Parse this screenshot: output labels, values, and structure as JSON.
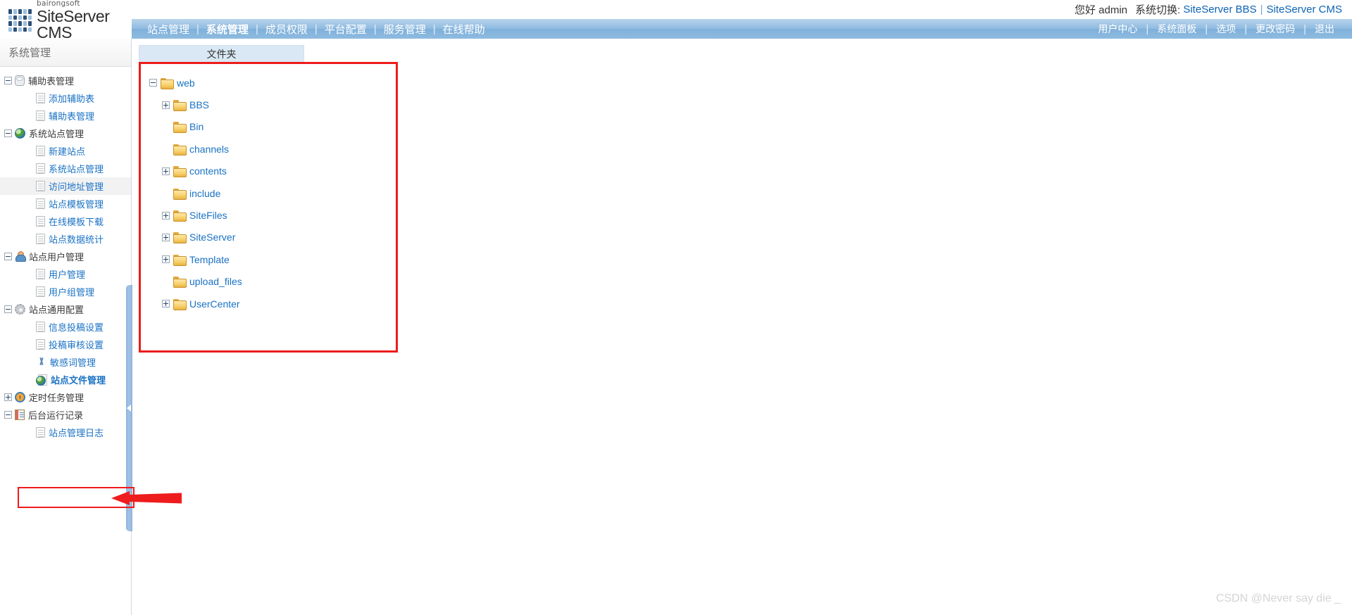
{
  "brand": {
    "sub": "bairongsoft",
    "name": "SiteServer CMS",
    "logo_icon": "grid-logo-icon"
  },
  "topbar": {
    "greeting": "您好 admin",
    "switch_label": "系统切换:",
    "switch_links": [
      "SiteServer BBS",
      "SiteServer CMS"
    ],
    "separator": "|"
  },
  "nav": {
    "primary": [
      {
        "label": "站点管理",
        "active": false
      },
      {
        "label": "系统管理",
        "active": true
      },
      {
        "label": "成员权限",
        "active": false
      },
      {
        "label": "平台配置",
        "active": false
      },
      {
        "label": "服务管理",
        "active": false
      },
      {
        "label": "在线帮助",
        "active": false
      }
    ],
    "secondary": [
      {
        "label": "用户中心"
      },
      {
        "label": "系统面板"
      },
      {
        "label": "选项"
      },
      {
        "label": "更改密码"
      },
      {
        "label": "退出"
      }
    ],
    "separator": "|"
  },
  "sidebar": {
    "title": "系统管理",
    "items": [
      {
        "label": "辅助表管理",
        "level": 1,
        "expander": "minus",
        "icon": "database-icon",
        "link": false
      },
      {
        "label": "添加辅助表",
        "level": 2,
        "expander": "none",
        "icon": "document-icon",
        "link": true
      },
      {
        "label": "辅助表管理",
        "level": 2,
        "expander": "none",
        "icon": "document-icon",
        "link": true
      },
      {
        "label": "系统站点管理",
        "level": 1,
        "expander": "minus",
        "icon": "globe-icon",
        "link": false
      },
      {
        "label": "新建站点",
        "level": 2,
        "expander": "none",
        "icon": "document-icon",
        "link": true
      },
      {
        "label": "系统站点管理",
        "level": 2,
        "expander": "none",
        "icon": "document-icon",
        "link": true
      },
      {
        "label": "访问地址管理",
        "level": 2,
        "expander": "none",
        "icon": "document-icon",
        "link": true,
        "highlighted": true
      },
      {
        "label": "站点模板管理",
        "level": 2,
        "expander": "none",
        "icon": "document-icon",
        "link": true
      },
      {
        "label": "在线模板下载",
        "level": 2,
        "expander": "none",
        "icon": "document-icon",
        "link": true
      },
      {
        "label": "站点数据统计",
        "level": 2,
        "expander": "none",
        "icon": "document-icon",
        "link": true
      },
      {
        "label": "站点用户管理",
        "level": 1,
        "expander": "minus",
        "icon": "user-icon",
        "link": false
      },
      {
        "label": "用户管理",
        "level": 2,
        "expander": "none",
        "icon": "document-icon",
        "link": true
      },
      {
        "label": "用户组管理",
        "level": 2,
        "expander": "none",
        "icon": "document-icon",
        "link": true
      },
      {
        "label": "站点通用配置",
        "level": 1,
        "expander": "minus",
        "icon": "gear-icon",
        "link": false
      },
      {
        "label": "信息投稿设置",
        "level": 2,
        "expander": "none",
        "icon": "document-icon",
        "link": true
      },
      {
        "label": "投稿审核设置",
        "level": 2,
        "expander": "none",
        "icon": "document-icon",
        "link": true
      },
      {
        "label": "敏感词管理",
        "level": 2,
        "expander": "none",
        "icon": "scissors-icon",
        "link": true
      },
      {
        "label": "站点文件管理",
        "level": 2,
        "expander": "none",
        "icon": "globe-doc-icon",
        "link": true,
        "selected": true
      },
      {
        "label": "定时任务管理",
        "level": 1,
        "expander": "plus",
        "icon": "clock-icon",
        "link": false
      },
      {
        "label": "后台运行记录",
        "level": 1,
        "expander": "minus",
        "icon": "book-icon",
        "link": false
      },
      {
        "label": "站点管理日志",
        "level": 2,
        "expander": "none",
        "icon": "document-icon",
        "link": true
      }
    ]
  },
  "splitter": {
    "handle_icon": "collapse-left-triangle-icon"
  },
  "content": {
    "tab_label": "文件夹",
    "folder_tree": [
      {
        "label": "web",
        "depth": 1,
        "expander": "minus",
        "icon": "folder-icon"
      },
      {
        "label": "BBS",
        "depth": 2,
        "expander": "plus",
        "icon": "folder-icon"
      },
      {
        "label": "Bin",
        "depth": 2,
        "expander": "none",
        "icon": "folder-icon"
      },
      {
        "label": "channels",
        "depth": 2,
        "expander": "none",
        "icon": "folder-icon"
      },
      {
        "label": "contents",
        "depth": 2,
        "expander": "plus",
        "icon": "folder-icon"
      },
      {
        "label": "include",
        "depth": 2,
        "expander": "none",
        "icon": "folder-icon"
      },
      {
        "label": "SiteFiles",
        "depth": 2,
        "expander": "plus",
        "icon": "folder-icon"
      },
      {
        "label": "SiteServer",
        "depth": 2,
        "expander": "plus",
        "icon": "folder-icon"
      },
      {
        "label": "Template",
        "depth": 2,
        "expander": "plus",
        "icon": "folder-icon"
      },
      {
        "label": "upload_files",
        "depth": 2,
        "expander": "none",
        "icon": "folder-icon"
      },
      {
        "label": "UserCenter",
        "depth": 2,
        "expander": "plus",
        "icon": "folder-icon"
      }
    ]
  },
  "annotations": {
    "highlight_color": "#ee1c1c",
    "arrow_icon": "red-left-arrow-icon",
    "box_icon": "red-rectangle-icon"
  },
  "watermark": {
    "text": "CSDN @Never say die _"
  },
  "colors": {
    "nav_blue": "#8fbbe0",
    "link_blue": "#1a72c4",
    "tab_blue": "#d9e8f4",
    "annotation_red": "#ee1c1c"
  }
}
